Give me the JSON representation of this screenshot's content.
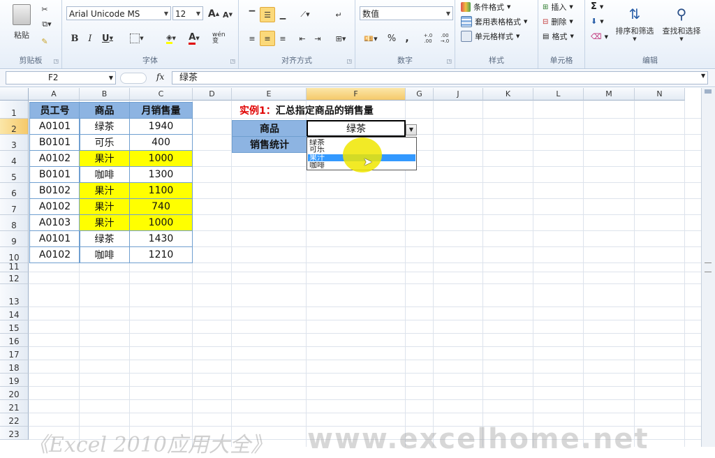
{
  "ribbon": {
    "clipboard": {
      "paste_label": "粘贴",
      "group_label": "剪贴板"
    },
    "font": {
      "font_name": "Arial Unicode MS",
      "font_size": "12",
      "bold": "B",
      "italic": "I",
      "underline": "U",
      "grow": "A",
      "shrink": "A",
      "font_color_label": "A",
      "phonetic_label": "wén 变",
      "group_label": "字体"
    },
    "alignment": {
      "group_label": "对齐方式"
    },
    "number": {
      "format_value": "数值",
      "percent": "%",
      "comma": ",",
      "inc_decimal": "+.0 .00",
      "dec_decimal": ".00 →.0",
      "group_label": "数字"
    },
    "styles": {
      "conditional": "条件格式",
      "table_format": "套用表格格式",
      "cell_styles": "单元格样式",
      "group_label": "样式"
    },
    "cells": {
      "insert": "插入",
      "delete": "删除",
      "format": "格式",
      "group_label": "单元格"
    },
    "editing": {
      "sigma": "Σ",
      "sort_filter": "排序和筛选",
      "find_select": "查找和选择",
      "group_label": "编辑"
    }
  },
  "formula_bar": {
    "name_box": "F2",
    "fx": "fx",
    "content": "绿茶"
  },
  "columns": [
    "A",
    "B",
    "C",
    "D",
    "E",
    "F",
    "G",
    "J",
    "K",
    "L",
    "M",
    "N"
  ],
  "rows": [
    "1",
    "2",
    "3",
    "4",
    "5",
    "6",
    "7",
    "8",
    "9",
    "10",
    "11",
    "12",
    "13",
    "14",
    "15",
    "16",
    "17",
    "18",
    "19",
    "20",
    "21",
    "22",
    "23"
  ],
  "table": {
    "headers": [
      "员工号",
      "商品",
      "月销售量"
    ],
    "rows": [
      [
        "A0101",
        "绿茶",
        "1940"
      ],
      [
        "B0101",
        "可乐",
        "400"
      ],
      [
        "A0102",
        "果汁",
        "1000"
      ],
      [
        "B0101",
        "咖啡",
        "1300"
      ],
      [
        "B0102",
        "果汁",
        "1100"
      ],
      [
        "A0102",
        "果汁",
        "740"
      ],
      [
        "A0103",
        "果汁",
        "1000"
      ],
      [
        "A0101",
        "绿茶",
        "1430"
      ],
      [
        "A0102",
        "咖啡",
        "1210"
      ]
    ]
  },
  "example": {
    "prefix": "实例1：",
    "title": "汇总指定商品的销售量",
    "label_product": "商品",
    "label_stats": "销售统计",
    "selected_value": "绿茶"
  },
  "dropdown": {
    "options": [
      "绿茶",
      "可乐",
      "果汁",
      "咖啡"
    ],
    "highlighted": 2
  },
  "watermark": {
    "left": "《Excel 2010应用大全》",
    "right": "www.excelhome.net"
  },
  "colors": {
    "header_fill": "#8db4e2",
    "highlight_fill": "#ffff00",
    "title_red": "#e00000"
  }
}
